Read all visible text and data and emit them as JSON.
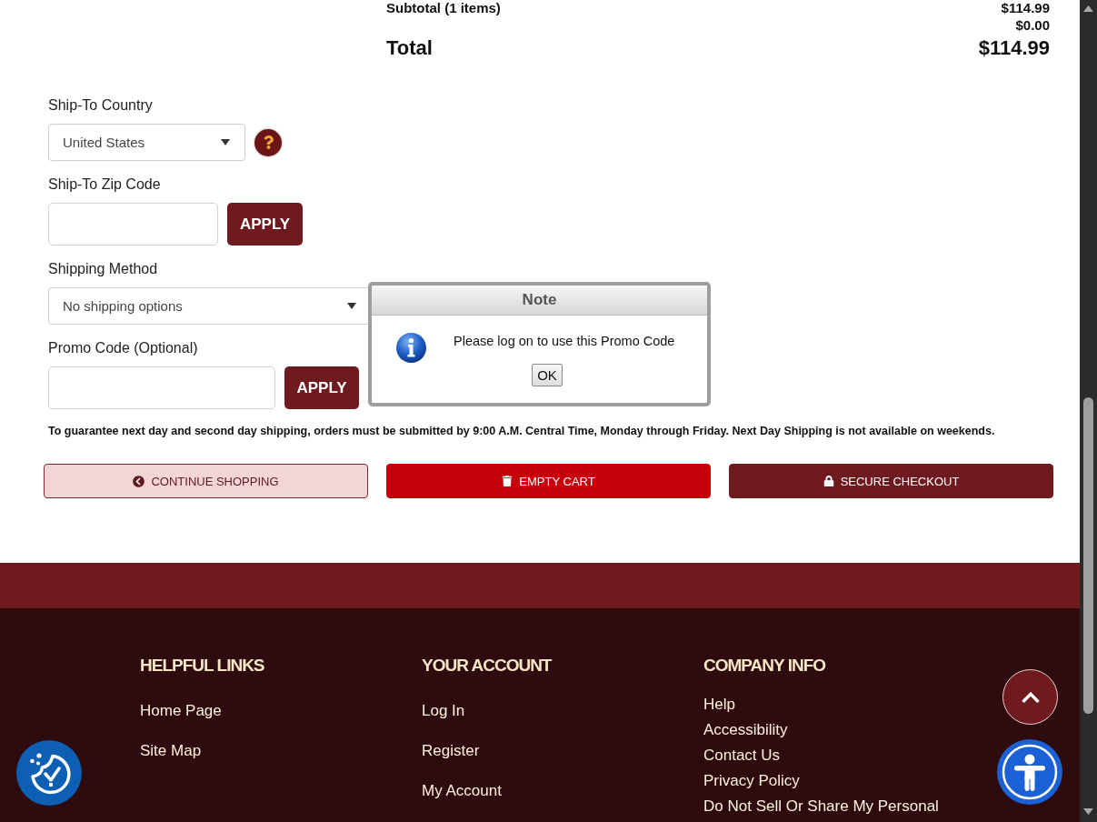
{
  "order_summary": {
    "rows": [
      {
        "label": "Subtotal (1 items)",
        "value": "$114.99"
      },
      {
        "value": "$0.00"
      }
    ],
    "total": {
      "label": "Total",
      "value": "$114.99"
    }
  },
  "shipping": {
    "fields": [
      {
        "kind": "select",
        "label": "Ship-To Country",
        "value": "United States",
        "help": true
      },
      {
        "kind": "input",
        "label": "Ship-To Zip Code",
        "button": "APPLY"
      },
      {
        "kind": "select",
        "label": "Shipping Method",
        "value": "No shipping options"
      },
      {
        "kind": "input",
        "label": "Promo Code (Optional)",
        "button": "APPLY"
      }
    ]
  },
  "notice": "To guarantee next day and second day shipping, orders must be submitted by 9:00 A.M. Central Time, Monday through Friday. Next Day Shipping is not available on weekends.",
  "actions": [
    {
      "kind": "continue",
      "label": "CONTINUE SHOPPING"
    },
    {
      "kind": "empty",
      "label": "EMPTY CART"
    },
    {
      "kind": "checkout",
      "label": "SECURE CHECKOUT"
    }
  ],
  "footer": {
    "columns": [
      {
        "heading": "HELPFUL LINKS",
        "links": [
          "Home Page",
          "Site Map"
        ]
      },
      {
        "heading": "YOUR ACCOUNT",
        "links": [
          "Log In",
          "Register",
          "My Account"
        ]
      },
      {
        "heading": "COMPANY INFO",
        "links": [
          "Help",
          "Accessibility",
          "Contact Us",
          "Privacy Policy",
          "Do Not Sell Or Share My Personal"
        ]
      }
    ]
  },
  "dialog": {
    "title": "Note",
    "message": "Please log on to use this Promo Code",
    "button": "OK"
  }
}
